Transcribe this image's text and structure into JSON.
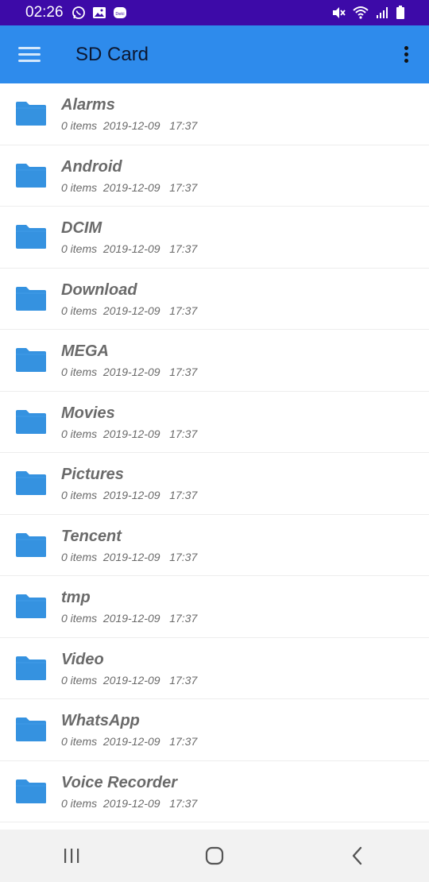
{
  "status_bar": {
    "time": "02:26",
    "left_icons": [
      "whatsapp-icon",
      "gallery-icon",
      "deki-icon"
    ],
    "right_icons": [
      "mute-icon",
      "wifi-icon",
      "signal-icon",
      "battery-icon"
    ]
  },
  "app_bar": {
    "title": "SD Card",
    "menu_icon": "hamburger-menu-icon",
    "more_icon": "more-vert-icon",
    "color": "#2e8bec"
  },
  "folders": [
    {
      "name": "Alarms",
      "items": "0 items",
      "date": "2019-12-09",
      "time": "17:37"
    },
    {
      "name": "Android",
      "items": "0 items",
      "date": "2019-12-09",
      "time": "17:37"
    },
    {
      "name": "DCIM",
      "items": "0 items",
      "date": "2019-12-09",
      "time": "17:37"
    },
    {
      "name": "Download",
      "items": "0 items",
      "date": "2019-12-09",
      "time": "17:37"
    },
    {
      "name": "MEGA",
      "items": "0 items",
      "date": "2019-12-09",
      "time": "17:37"
    },
    {
      "name": "Movies",
      "items": "0 items",
      "date": "2019-12-09",
      "time": "17:37"
    },
    {
      "name": "Pictures",
      "items": "0 items",
      "date": "2019-12-09",
      "time": "17:37"
    },
    {
      "name": "Tencent",
      "items": "0 items",
      "date": "2019-12-09",
      "time": "17:37"
    },
    {
      "name": "tmp",
      "items": "0 items",
      "date": "2019-12-09",
      "time": "17:37"
    },
    {
      "name": "Video",
      "items": "0 items",
      "date": "2019-12-09",
      "time": "17:37"
    },
    {
      "name": "WhatsApp",
      "items": "0 items",
      "date": "2019-12-09",
      "time": "17:37"
    },
    {
      "name": "Voice Recorder",
      "items": "0 items",
      "date": "2019-12-09",
      "time": "17:37"
    }
  ],
  "folder_icon_color": "#3592e0",
  "nav_bar": {
    "buttons": [
      "recents-icon",
      "home-icon",
      "back-icon"
    ]
  }
}
